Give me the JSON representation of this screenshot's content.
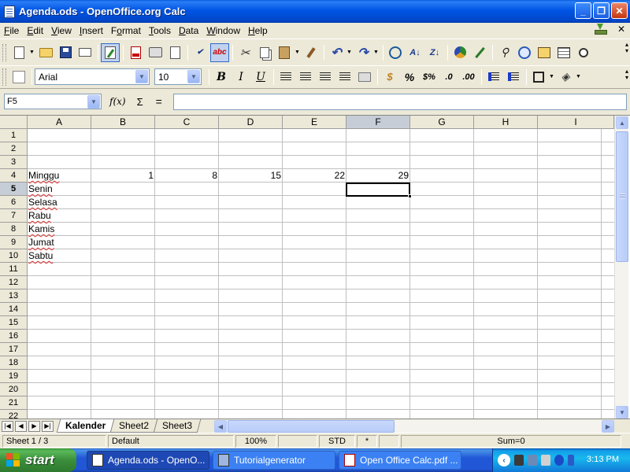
{
  "window": {
    "title": "Agenda.ods - OpenOffice.org Calc"
  },
  "menu": [
    "File",
    "Edit",
    "View",
    "Insert",
    "Format",
    "Tools",
    "Data",
    "Window",
    "Help"
  ],
  "menu_mnemonic": [
    "F",
    "E",
    "V",
    "I",
    "o",
    "T",
    "D",
    "W",
    "H"
  ],
  "format_toolbar": {
    "font_name": "Arial",
    "font_size": "10"
  },
  "formula_bar": {
    "name_box": "F5",
    "formula": ""
  },
  "columns": [
    "A",
    "B",
    "C",
    "D",
    "E",
    "F",
    "G",
    "H",
    "I"
  ],
  "selected_column": "F",
  "rows": [
    "1",
    "2",
    "3",
    "4",
    "5",
    "6",
    "7",
    "8",
    "9",
    "10",
    "11",
    "12",
    "13",
    "14",
    "15",
    "16",
    "17",
    "18",
    "19",
    "20",
    "21",
    "22"
  ],
  "selected_row": "5",
  "cells": {
    "A4": "Minggu",
    "A5": "Senin",
    "A6": "Selasa",
    "A7": "Rabu",
    "A8": "Kamis",
    "A9": "Jumat",
    "A10": "Sabtu",
    "B4": "1",
    "C4": "8",
    "D4": "15",
    "E4": "22",
    "F4": "29"
  },
  "sheet_tabs": [
    "Kalender",
    "Sheet2",
    "Sheet3"
  ],
  "active_tab": "Kalender",
  "status": {
    "sheet": "Sheet 1 / 3",
    "page_style": "Default",
    "zoom": "100%",
    "mode": "STD",
    "modified": "*",
    "sum": "Sum=0"
  },
  "taskbar": {
    "start": "start",
    "tasks": [
      "Agenda.ods - OpenO...",
      "Tutorialgenerator",
      "Open Office Calc.pdf ..."
    ],
    "clock": "3:13 PM"
  },
  "colors": {
    "titlebar": "#0055e5",
    "selected_header": "#c7cdd6",
    "spellcheck_underline": "#e03030"
  }
}
